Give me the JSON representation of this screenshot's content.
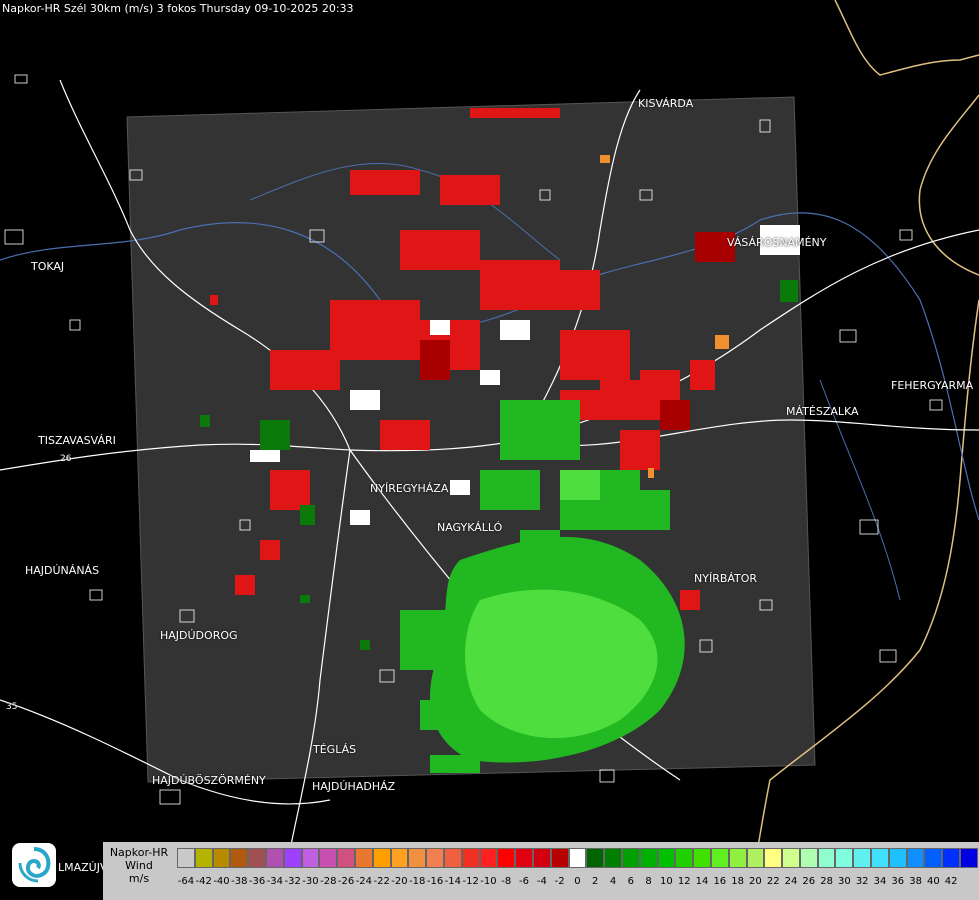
{
  "header": {
    "title": "Napkor-HR Szél 30km (m/s) 3 fokos Thursday 09-10-2025 20:33"
  },
  "places": [
    {
      "name": "KISVÁRDA"
    },
    {
      "name": "VÁSÁROSNAMÉNY"
    },
    {
      "name": "TOKAJ"
    },
    {
      "name": "FEHERGYARMA"
    },
    {
      "name": "MÁTÉSZALKA"
    },
    {
      "name": "TISZAVASVÁRI"
    },
    {
      "name": "NYÍREGYHÁZA"
    },
    {
      "name": "NAGYKÁLLÓ"
    },
    {
      "name": "HAJDÚNÁNÁS"
    },
    {
      "name": "NYÍRBÁTOR"
    },
    {
      "name": "HAJDÚDOROG"
    },
    {
      "name": "TÉGLÁS"
    },
    {
      "name": "HAJDÚBÖSZÖRMÉNY"
    },
    {
      "name": "HAJDÚHADHÁZ"
    }
  ],
  "road_numbers": [
    "26",
    "35"
  ],
  "logo": {
    "text": "LMAZÚJVÁR",
    "icon": "weather-swirl-icon"
  },
  "legend": {
    "line1": "Napkor-HR",
    "line2": "Wind",
    "line3": "m/s",
    "colors": [
      "#c9c9c9",
      "#b3b300",
      "#b88a00",
      "#b05a10",
      "#a05050",
      "#b050b0",
      "#a040ff",
      "#c060e0",
      "#c850b0",
      "#d05080",
      "#e87830",
      "#ffa000",
      "#ffa020",
      "#f09040",
      "#f08050",
      "#f06040",
      "#f03020",
      "#ff2020",
      "#ff0000",
      "#e00010",
      "#d00010",
      "#b80000",
      "#ffffff",
      "#006400",
      "#008000",
      "#00a000",
      "#00b000",
      "#00c000",
      "#20d000",
      "#40e000",
      "#60f020",
      "#90f040",
      "#b0f060",
      "#ffff80",
      "#d0ff90",
      "#b0ffb0",
      "#90ffd0",
      "#80ffe0",
      "#60f0f0",
      "#40e0ff",
      "#20c0ff",
      "#1090ff",
      "#0060ff",
      "#0030ff",
      "#0000e0"
    ],
    "ticks": [
      "-64",
      "-42",
      "-40",
      "-38",
      "-36",
      "-34",
      "-32",
      "-30",
      "-28",
      "-26",
      "-24",
      "-22",
      "-20",
      "-18",
      "-16",
      "-14",
      "-12",
      "-10",
      "-8",
      "-6",
      "-4",
      "-2",
      "0",
      "2",
      "4",
      "6",
      "8",
      "10",
      "12",
      "14",
      "16",
      "18",
      "20",
      "22",
      "24",
      "26",
      "28",
      "30",
      "32",
      "34",
      "36",
      "38",
      "40",
      "42"
    ]
  }
}
